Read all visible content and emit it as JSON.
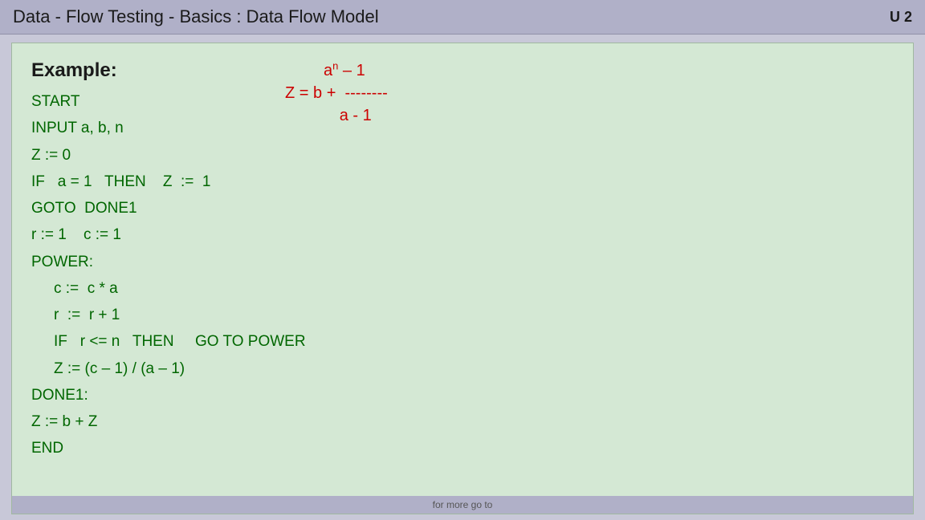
{
  "titleBar": {
    "title": "Data - Flow Testing   -  Basics : Data Flow Model",
    "unit": "U 2"
  },
  "content": {
    "exampleLabel": "Example:",
    "formulaParts": {
      "zbPlus": "Z  =  b  +",
      "dashes": "--------",
      "numerator": "aⁿ – 1",
      "denominator": "a  -  1"
    },
    "codeLines": [
      {
        "text": "START",
        "indent": false
      },
      {
        "text": "INPUT a, b, n",
        "indent": false
      },
      {
        "text": "Z := 0",
        "indent": false
      },
      {
        "text": "IF   a = 1   THEN    Z  :=  1",
        "indent": false
      },
      {
        "text": "GOTO  DONE1",
        "indent": false
      },
      {
        "text": "r := 1    c := 1",
        "indent": false
      },
      {
        "text": "POWER:",
        "indent": false
      },
      {
        "text": "c :=  c * a",
        "indent": true
      },
      {
        "text": "r  :=  r + 1",
        "indent": true
      },
      {
        "text": "IF   r <= n   THEN     GO TO POWER",
        "indent": true
      },
      {
        "text": "Z := (c – 1) / (a – 1)",
        "indent": true
      },
      {
        "text": "DONE1:",
        "indent": false
      },
      {
        "text": "Z := b + Z",
        "indent": false
      },
      {
        "text": "END",
        "indent": false
      }
    ]
  },
  "bottomBar": {
    "text": "for more go to"
  }
}
